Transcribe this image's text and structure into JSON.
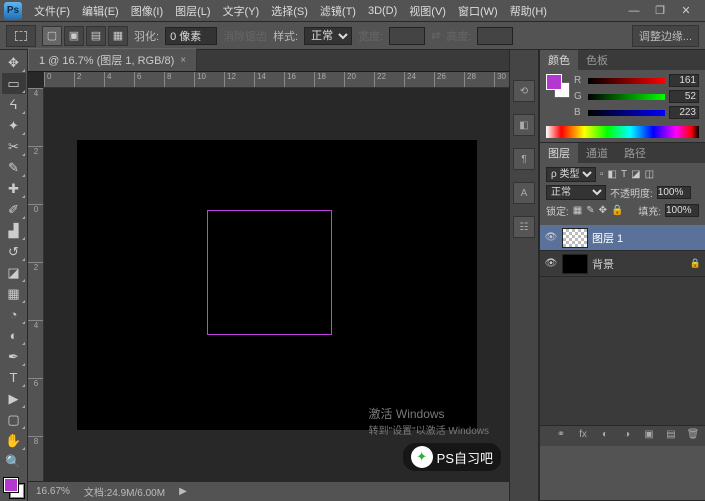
{
  "app": {
    "logo": "Ps"
  },
  "menu": [
    "文件(F)",
    "编辑(E)",
    "图像(I)",
    "图层(L)",
    "文字(Y)",
    "选择(S)",
    "滤镜(T)",
    "3D(D)",
    "视图(V)",
    "窗口(W)",
    "帮助(H)"
  ],
  "options": {
    "feather_label": "羽化:",
    "feather_value": "0 像素",
    "antialias": "消除锯齿",
    "style_label": "样式:",
    "style_value": "正常",
    "width_label": "宽度:",
    "height_label": "高度:",
    "refine": "调整边缘..."
  },
  "document": {
    "tab": "1 @ 16.7% (图层 1, RGB/8)",
    "close": "×",
    "ruler_h": [
      "0",
      "2",
      "4",
      "6",
      "8",
      "10",
      "12",
      "14",
      "16",
      "18",
      "20",
      "22",
      "24",
      "26",
      "28",
      "30"
    ],
    "ruler_v": [
      "4",
      "2",
      "0",
      "2",
      "4",
      "6",
      "8"
    ]
  },
  "status": {
    "zoom": "16.67%",
    "docinfo": "文档:24.9M/6.00M"
  },
  "dock": [
    "⟲",
    "◧",
    "¶",
    "A",
    "☷"
  ],
  "colorPanel": {
    "tabs": {
      "color": "颜色",
      "swatches": "色板"
    },
    "r_label": "R",
    "r_value": "161",
    "g_label": "G",
    "g_value": "52",
    "b_label": "B",
    "b_value": "223"
  },
  "layersPanel": {
    "tabs": {
      "layers": "图层",
      "channels": "通道",
      "paths": "路径"
    },
    "kind_label": "ρ 类型",
    "blend": "正常",
    "opacity_label": "不透明度:",
    "opacity_value": "100%",
    "lock_label": "锁定:",
    "fill_label": "填充:",
    "fill_value": "100%",
    "layers": [
      {
        "name": "图层 1",
        "visible": true,
        "active": true,
        "thumb": "trans"
      },
      {
        "name": "背景",
        "visible": true,
        "active": false,
        "thumb": "black",
        "locked": true
      }
    ]
  },
  "watermark": {
    "l1": "激活 Windows",
    "l2": "转到\"设置\"以激活 Windows"
  },
  "badge": {
    "text": "PS自习吧"
  },
  "chart_data": null
}
